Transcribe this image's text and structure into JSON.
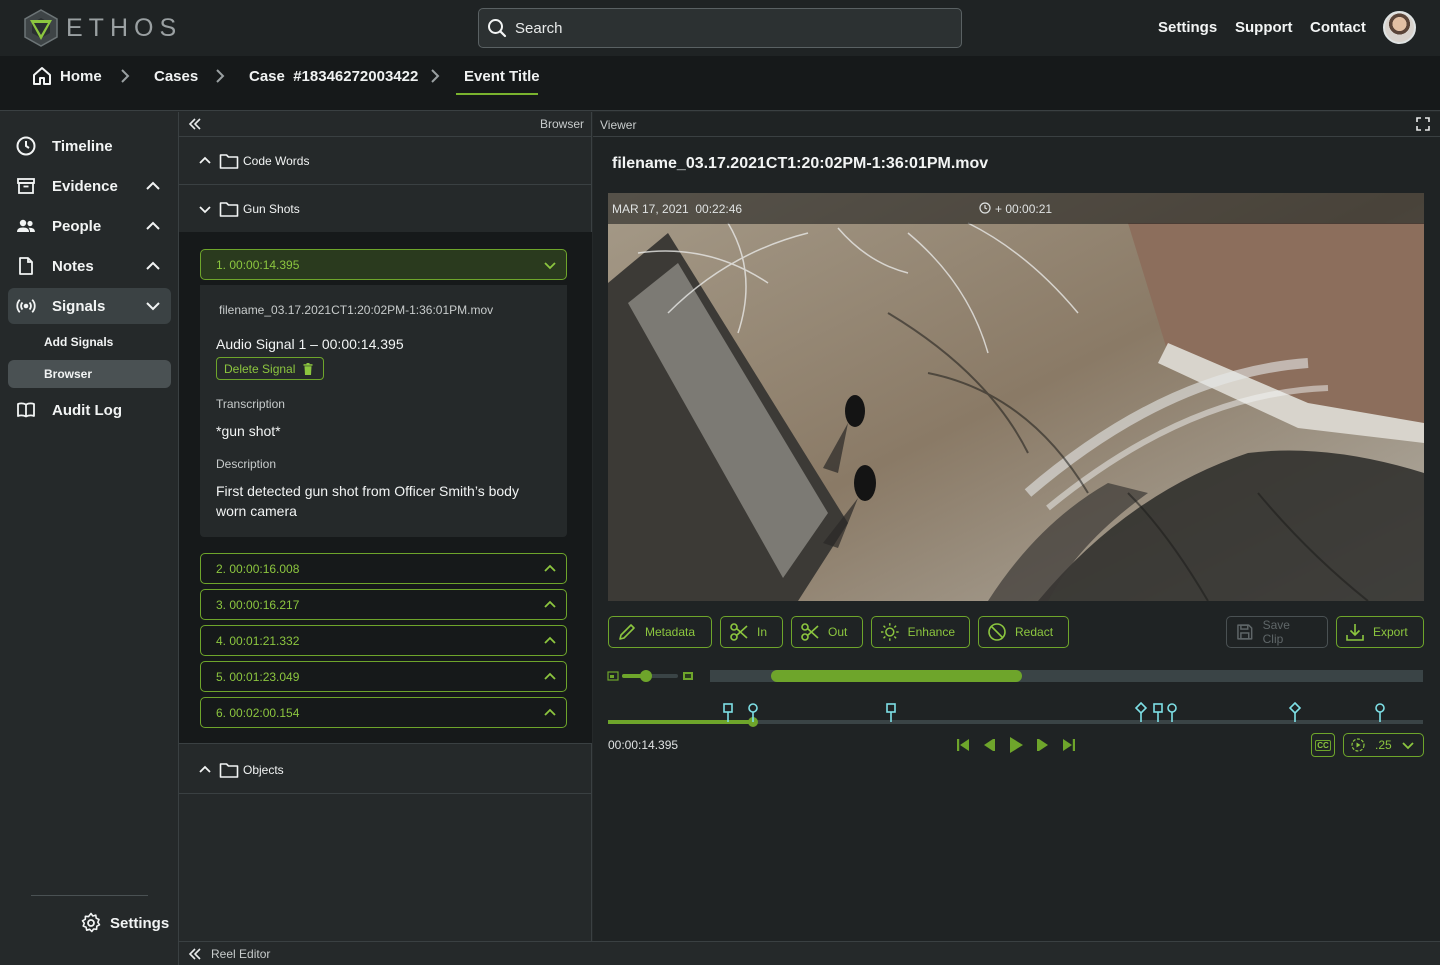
{
  "app": {
    "logo_text": "ETHOS"
  },
  "search": {
    "placeholder": "Search"
  },
  "toplinks": {
    "settings": "Settings",
    "support": "Support",
    "contact": "Contact"
  },
  "breadcrumb": {
    "home": "Home",
    "cases": "Cases",
    "case": "Case  #18346272003422",
    "event": "Event Title"
  },
  "sidebar": {
    "timeline": "Timeline",
    "evidence": "Evidence",
    "people": "People",
    "notes": "Notes",
    "signals": "Signals",
    "add_signals": "Add Signals",
    "browser": "Browser",
    "audit_log": "Audit Log",
    "settings": "Settings"
  },
  "browser": {
    "header": "Browser",
    "folders": {
      "code_words": "Code Words",
      "gun_shots": "Gun Shots",
      "objects": "Objects"
    },
    "signals": [
      "1. 00:00:14.395",
      "2. 00:00:16.008",
      "3. 00:00:16.217",
      "4. 00:01:21.332",
      "5. 00:01:23.049",
      "6. 00:02:00.154"
    ],
    "detail": {
      "filename": "filename_03.17.2021CT1:20:02PM-1:36:01PM.mov",
      "title": "Audio Signal 1 – 00:00:14.395",
      "delete_label": "Delete Signal",
      "transcription_label": "Transcription",
      "transcription": "*gun shot*",
      "description_label": "Description",
      "description": "First detected gun shot from Officer Smith’s body worn camera"
    }
  },
  "viewer": {
    "header": "Viewer",
    "title": "filename_03.17.2021CT1:20:02PM-1:36:01PM.mov",
    "video_date": "MAR 17, 2021  00:22:46",
    "video_offset": "+ 00:00:21",
    "tools": {
      "metadata": "Metadata",
      "in": "In",
      "out": "Out",
      "enhance": "Enhance",
      "redact": "Redact",
      "save_clip": "Save Clip",
      "export": "Export"
    },
    "current_time": "00:00:14.395",
    "speed": ".25",
    "cc": "CC",
    "accent": "#6ea52b",
    "marker_color": "#7ee0e6"
  },
  "footer": {
    "reel_editor": "Reel Editor"
  }
}
